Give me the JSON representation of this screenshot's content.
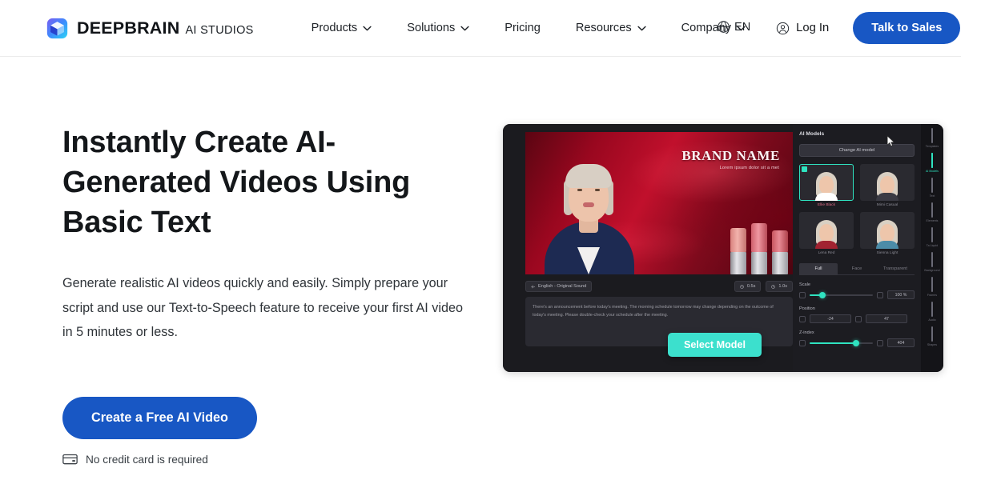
{
  "header": {
    "brand": {
      "main": "DEEPBRAIN",
      "sub": "AI STUDIOS",
      "logo_icon": "cube-logo-icon"
    },
    "nav": [
      {
        "label": "Products",
        "has_caret": true,
        "icon": "chevron-down-icon"
      },
      {
        "label": "Solutions",
        "has_caret": true,
        "icon": "chevron-down-icon"
      },
      {
        "label": "Pricing",
        "has_caret": false
      },
      {
        "label": "Resources",
        "has_caret": true,
        "icon": "chevron-down-icon"
      },
      {
        "label": "Company",
        "has_caret": true,
        "icon": "chevron-down-icon"
      }
    ],
    "language": {
      "label": "EN",
      "icon": "globe-icon"
    },
    "login": {
      "label": "Log In",
      "icon": "user-circle-icon"
    },
    "cta": {
      "label": "Talk to Sales"
    },
    "accent_color": "#1857c4"
  },
  "hero": {
    "title": "Instantly Create AI-Generated Videos Using Basic Text",
    "description": "Generate realistic AI videos quickly and easily. Simply prepare your script and use our Text-to-Speech feature to receive your first AI video in 5 minutes or less.",
    "cta_label": "Create a Free AI Video",
    "no_card_note": "No credit card is required",
    "no_card_icon": "credit-card-icon"
  },
  "mockup": {
    "canvas": {
      "brand_name": "BRAND NAME",
      "brand_tagline": "Lorem ipsum dolor sit a met"
    },
    "toolbar": {
      "voice_chip": "English - Original Sound",
      "voice_icon": "waveform-icon",
      "duration_chip": "0.5s",
      "duration_icon": "clock-icon",
      "total_chip": "1.0s",
      "total_icon": "clock-icon"
    },
    "script": "There's an announcement before today's meeting. The morning schedule tomorrow may change depending on the outcome of today's meeting. Please double-check your schedule after the meeting.",
    "panel": {
      "title": "AI Models",
      "change_button": "Change AI model",
      "models": [
        {
          "label": "Ellie Black",
          "selected": true,
          "body_color": "#ffffff",
          "hair_color": "#ded6c9"
        },
        {
          "label": "Mimi Casual",
          "selected": false,
          "body_color": "#3b3b44",
          "hair_color": "#e3dbcd"
        },
        {
          "label": "Lena Red",
          "selected": false,
          "body_color": "#a12331",
          "hair_color": "#e8d9b8"
        },
        {
          "label": "Sienna Light",
          "selected": false,
          "body_color": "#4c8ca8",
          "hair_color": "#ded3bd"
        }
      ],
      "tabs": [
        {
          "label": "Full",
          "active": true
        },
        {
          "label": "Face",
          "active": false
        },
        {
          "label": "Transparent",
          "active": false
        }
      ],
      "controls": [
        {
          "name": "Scale",
          "type": "slider",
          "fill_pct": 18,
          "value": "100 %"
        },
        {
          "name": "Position",
          "type": "pair",
          "value_x": "-24",
          "value_y": "47"
        },
        {
          "name": "Z-index",
          "type": "slider",
          "fill_pct": 72,
          "value": "404"
        }
      ]
    },
    "rail": [
      {
        "label": "Templates",
        "icon": "templates-icon",
        "active": false
      },
      {
        "label": "AI Models",
        "icon": "ai-model-icon",
        "active": true
      },
      {
        "label": "Text",
        "icon": "text-icon",
        "active": false
      },
      {
        "label": "Elements",
        "icon": "elements-icon",
        "active": false
      },
      {
        "label": "Ta Liquid",
        "icon": "image-icon",
        "active": false
      },
      {
        "label": "Background",
        "icon": "background-icon",
        "active": false
      },
      {
        "label": "Frames",
        "icon": "frames-icon",
        "active": false
      },
      {
        "label": "Audio",
        "icon": "audio-icon",
        "active": false
      },
      {
        "label": "Shapes",
        "icon": "shapes-icon",
        "active": false
      }
    ],
    "overlay_button": "Select Model",
    "cursor_icon": "mouse-cursor-icon",
    "accent_teal": "#2fe3c0"
  }
}
